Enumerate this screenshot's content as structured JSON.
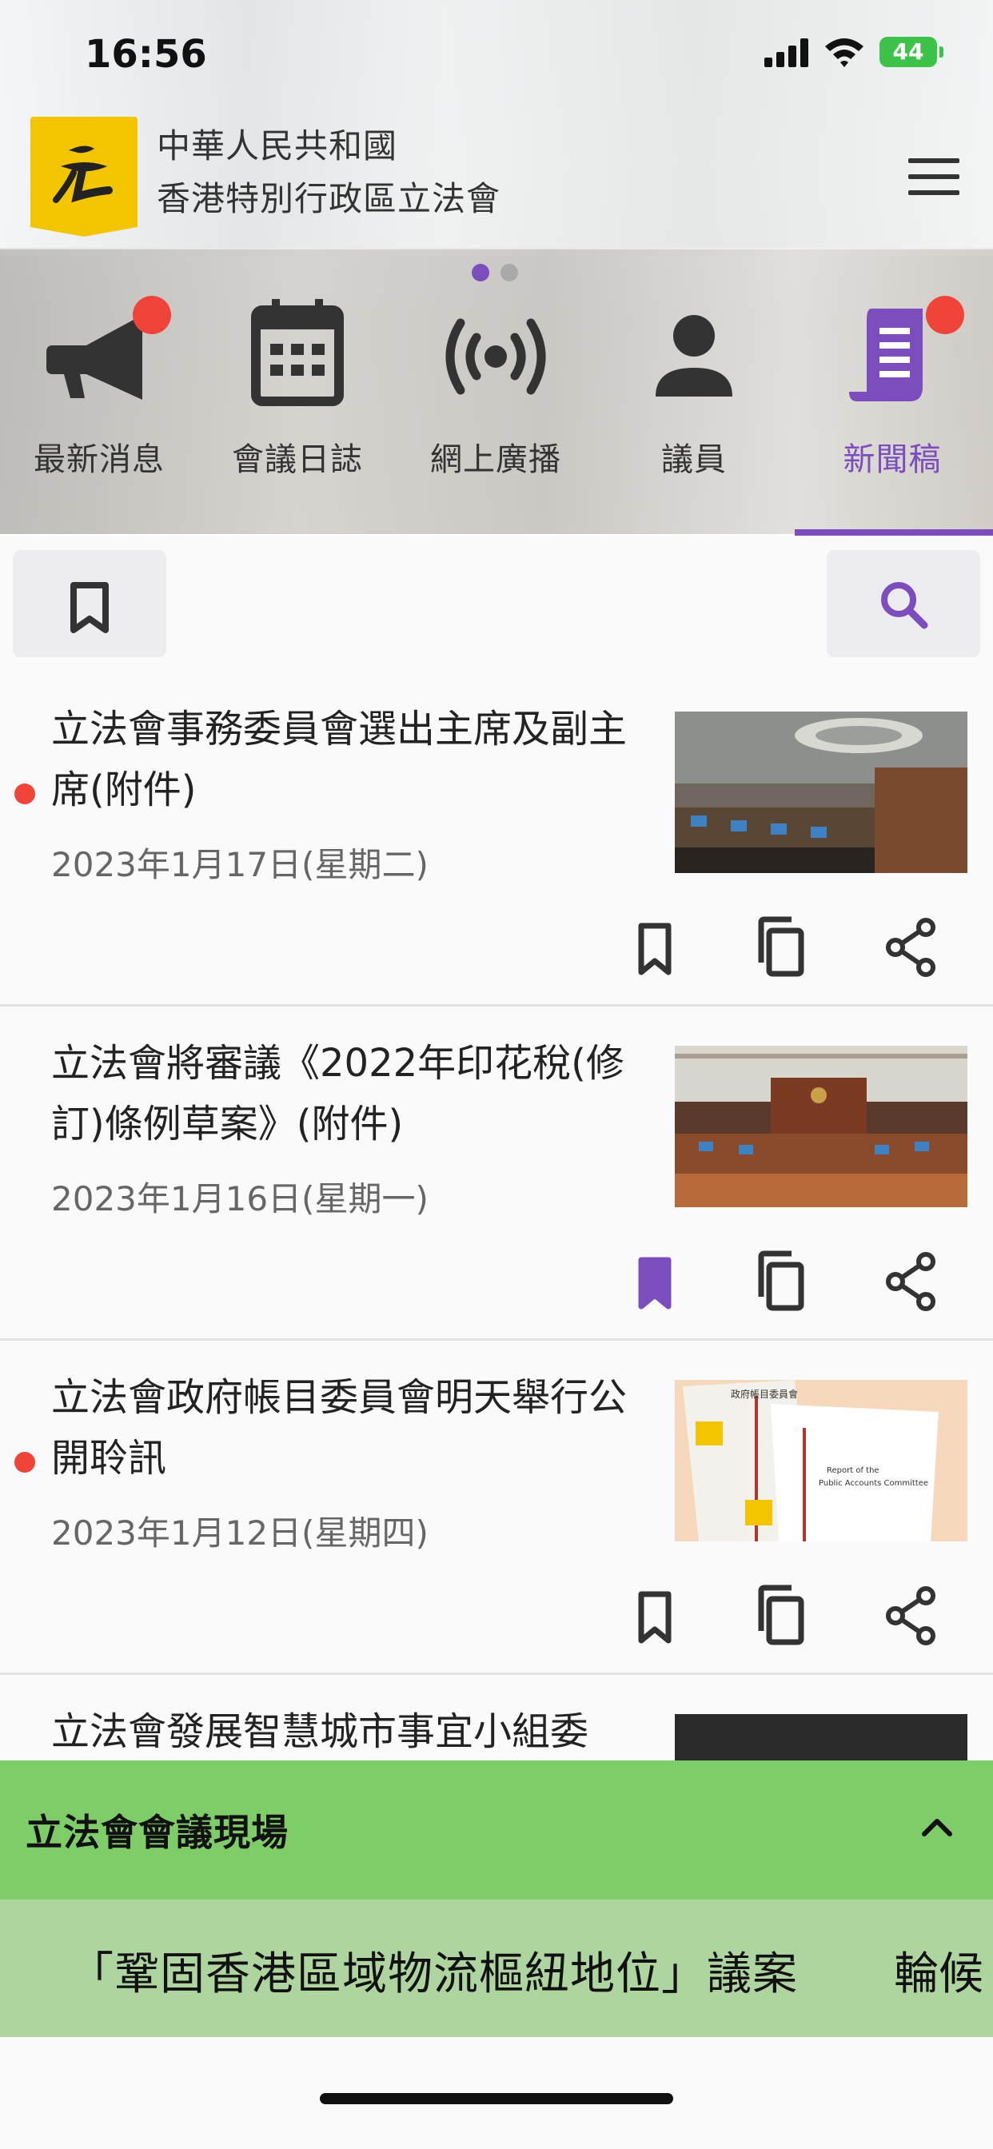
{
  "status_bar": {
    "time": "16:56",
    "battery": "44"
  },
  "header": {
    "org_line1": "中華人民共和國",
    "org_line2": "香港特別行政區立法會",
    "logo_icon": "legco-logo-icon",
    "menu_icon": "hamburger-menu-icon"
  },
  "pager": {
    "pages": 2,
    "active": 1
  },
  "nav": {
    "items": [
      {
        "label": "最新消息",
        "icon": "megaphone-icon",
        "badge": true
      },
      {
        "label": "會議日誌",
        "icon": "calendar-icon",
        "badge": false
      },
      {
        "label": "網上廣播",
        "icon": "broadcast-icon",
        "badge": false
      },
      {
        "label": "議員",
        "icon": "person-icon",
        "badge": false
      },
      {
        "label": "新聞稿",
        "icon": "press-release-icon",
        "badge": true,
        "active": true
      }
    ],
    "active_color": "#7c4dbd"
  },
  "toolbar": {
    "bookmark_icon": "bookmark-outline-icon",
    "search_icon": "search-icon"
  },
  "news": [
    {
      "title": "立法會事務委員會選出主席及副主席(附件)",
      "date": "2023年1月17日(星期二)",
      "unread": true,
      "bookmarked": false
    },
    {
      "title": "立法會將審議《2022年印花稅(修訂)條例草案》(附件)",
      "date": "2023年1月16日(星期一)",
      "unread": false,
      "bookmarked": true
    },
    {
      "title": "立法會政府帳目委員會明天舉行公開聆訊",
      "date": "2023年1月12日(星期四)",
      "unread": true,
      "bookmarked": false
    },
    {
      "title": "立法會發展智慧城市事宜小組委",
      "date": "",
      "unread": false,
      "bookmarked": false
    }
  ],
  "thumb_texts": {
    "pac_cn": "政府帳目委員會",
    "pac_en1": "Report of the",
    "pac_en2": "Public Accounts Committee"
  },
  "live": {
    "title": "立法會會議現場",
    "ticker": "「鞏固香港區域物流樞紐地位」議案",
    "ticker_next": "輪候",
    "chevron_icon": "chevron-up-icon"
  },
  "colors": {
    "accent": "#7c4dbd",
    "badge": "#f04438",
    "live_bar": "#7fcd68",
    "ticker_bg": "#aed49f"
  }
}
